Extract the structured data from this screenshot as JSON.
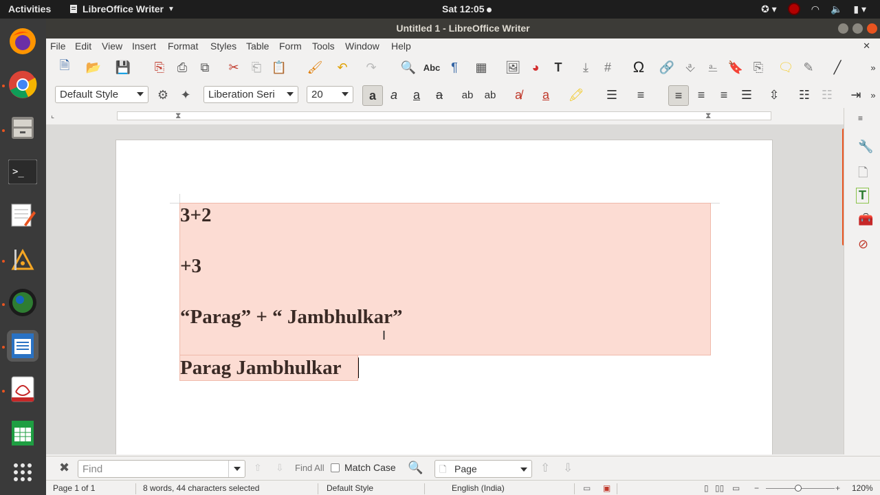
{
  "topbar": {
    "activities": "Activities",
    "app_name": "LibreOffice Writer",
    "clock": "Sat 12:05"
  },
  "window": {
    "title": "Untitled 1 - LibreOffice Writer"
  },
  "menu": [
    "File",
    "Edit",
    "View",
    "Insert",
    "Format",
    "Styles",
    "Table",
    "Form",
    "Tools",
    "Window",
    "Help"
  ],
  "format_toolbar": {
    "paragraph_style": "Default Style",
    "font_name": "Liberation Seri",
    "font_size": "20"
  },
  "document": {
    "lines": [
      "3+2",
      "+3",
      "“Parag” + “ Jambhulkar”",
      "Parag Jambhulkar"
    ]
  },
  "findbar": {
    "placeholder": "Find",
    "find_all": "Find All",
    "match_case": "Match Case",
    "search_scope": "Page"
  },
  "statusbar": {
    "page": "Page 1 of 1",
    "words": "8 words, 44 characters selected",
    "style": "Default Style",
    "language": "English (India)",
    "zoom": "120%"
  },
  "colors": {
    "accent": "#e95420",
    "selection": "#fcdcd3",
    "text": "#3a2a25"
  }
}
